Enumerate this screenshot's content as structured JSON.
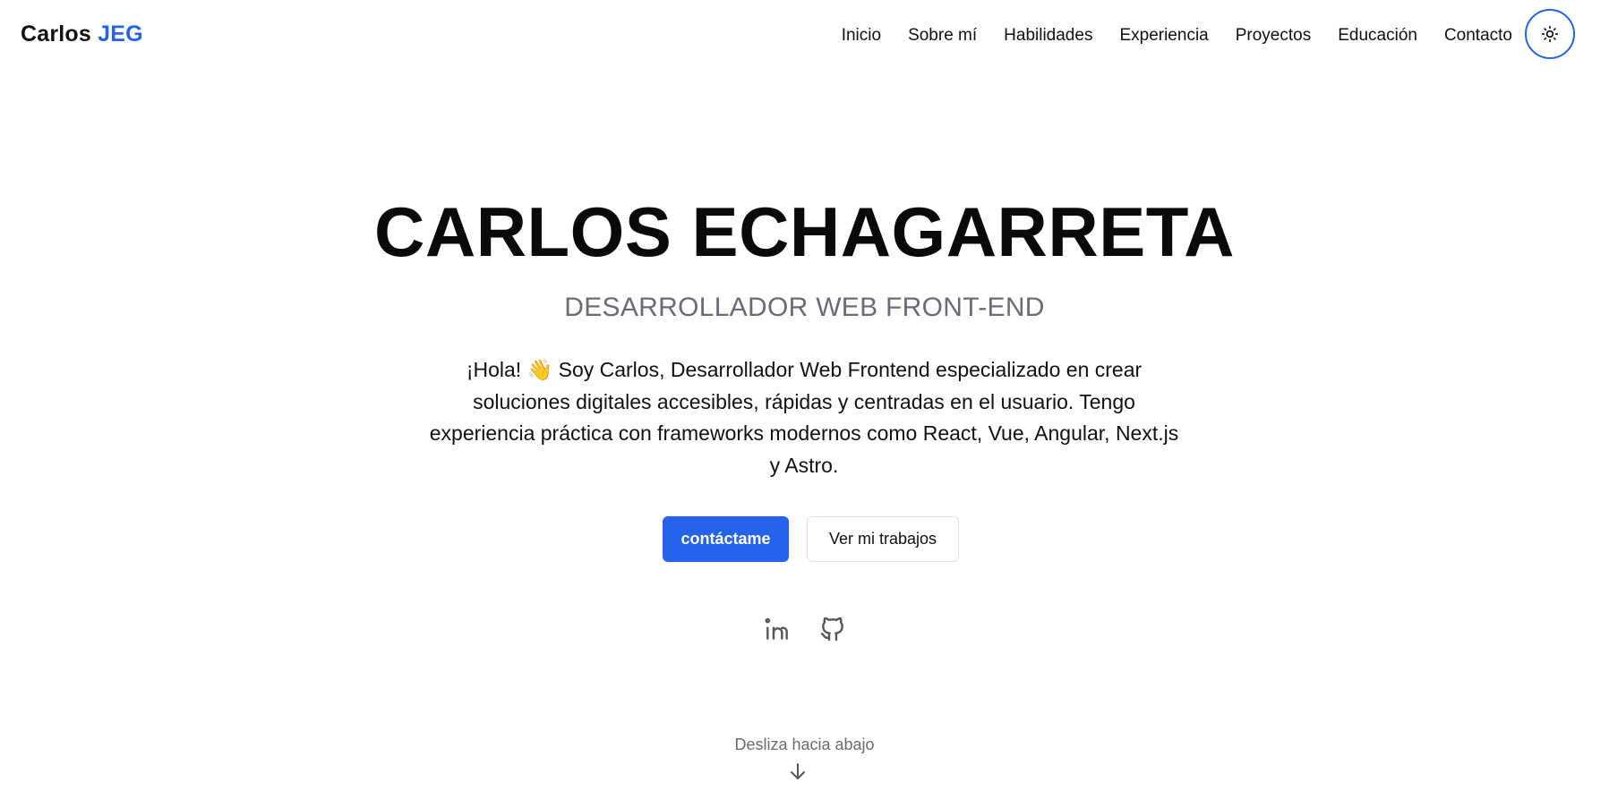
{
  "header": {
    "logo_first": "Carlos",
    "logo_accent": "JEG",
    "nav": [
      {
        "label": "Inicio"
      },
      {
        "label": "Sobre mí"
      },
      {
        "label": "Habilidades"
      },
      {
        "label": "Experiencia"
      },
      {
        "label": "Proyectos"
      },
      {
        "label": "Educación"
      },
      {
        "label": "Contacto"
      }
    ],
    "theme_icon": "sun-icon"
  },
  "hero": {
    "name": "CARLOS ECHAGARRETA",
    "role": "DESARROLLADOR WEB FRONT-END",
    "intro": "¡Hola! 👋 Soy Carlos, Desarrollador Web Frontend especializado en crear soluciones digitales accesibles, rápidas y centradas en el usuario. Tengo experiencia práctica con frameworks modernos como React, Vue, Angular, Next.js y Astro.",
    "primary_button": "contáctame",
    "secondary_button": "Ver mi trabajos"
  },
  "social": {
    "icons": [
      "linkedin-icon",
      "github-icon"
    ]
  },
  "scroll": {
    "label": "Desliza hacia abajo",
    "icon": "arrow-down-icon"
  },
  "colors": {
    "accent": "#2563eb",
    "muted": "#6b6b76",
    "text": "#111111"
  }
}
